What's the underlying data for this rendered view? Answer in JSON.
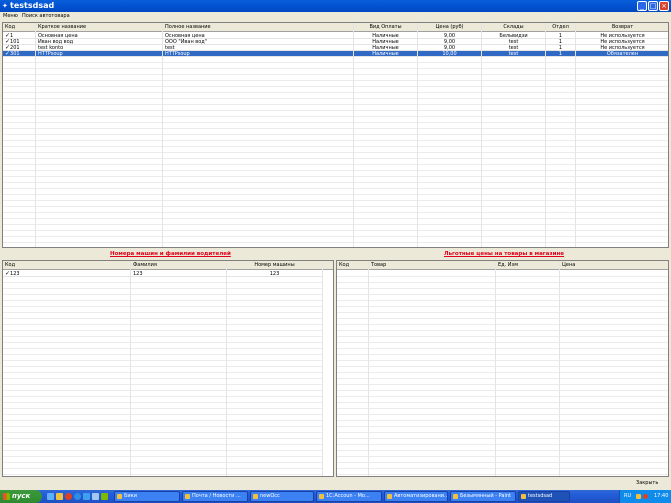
{
  "window": {
    "title": "testsdsad"
  },
  "menu": [
    "Меню",
    "Поиск автотовара"
  ],
  "main_grid": {
    "columns": [
      "Код",
      "Краткое название",
      "Полное название",
      "Вид Оплаты",
      "Цена (руб)",
      "Склады",
      "Отдел",
      "Возврат"
    ],
    "rows": [
      {
        "checked": true,
        "cells": [
          "1",
          "Основная цена",
          "Основная цена",
          "Наличные",
          "9,00",
          "Бельвидзи",
          "1",
          "Не используется"
        ]
      },
      {
        "checked": true,
        "cells": [
          "101",
          "Иван вод вод",
          "ООО \"Иван вод\"",
          "Наличные",
          "9,00",
          "test",
          "1",
          "Не используется"
        ]
      },
      {
        "checked": true,
        "cells": [
          "201",
          "test konto",
          "test",
          "Наличные",
          "9,00",
          "test",
          "1",
          "Не используется"
        ]
      },
      {
        "checked": true,
        "selected": true,
        "cells": [
          "301",
          "HTTPsoup",
          "HTTPsoup",
          "Наличные",
          "10,00",
          "test",
          "1",
          "Обязателен"
        ]
      }
    ]
  },
  "left_panel": {
    "title": "Номера машин и фамилии водителей",
    "columns": [
      "Код",
      "Фамилия",
      "Номер машины"
    ],
    "rows": [
      {
        "checked": true,
        "cells": [
          "123",
          "123",
          "123"
        ]
      }
    ]
  },
  "right_panel": {
    "title": "Льготные цены на товары в магазине",
    "columns": [
      "Код",
      "Товар",
      "Ед. Изм",
      "Цена"
    ]
  },
  "footer": {
    "close_label": "Закрыть"
  },
  "taskbar": {
    "start_label": "пуск",
    "tasks": [
      {
        "label": "Бики",
        "active": false
      },
      {
        "label": "Почта / Новости ...",
        "active": false
      },
      {
        "label": "newOcc",
        "active": false
      },
      {
        "label": "1С:Accoun - Мо...",
        "active": false
      },
      {
        "label": "Автоматизировани...",
        "active": false
      },
      {
        "label": "Безымянный - Paint",
        "active": false
      },
      {
        "label": "testsdsad",
        "active": true
      }
    ],
    "tray": {
      "lang": "RU",
      "time": "17:40"
    }
  }
}
